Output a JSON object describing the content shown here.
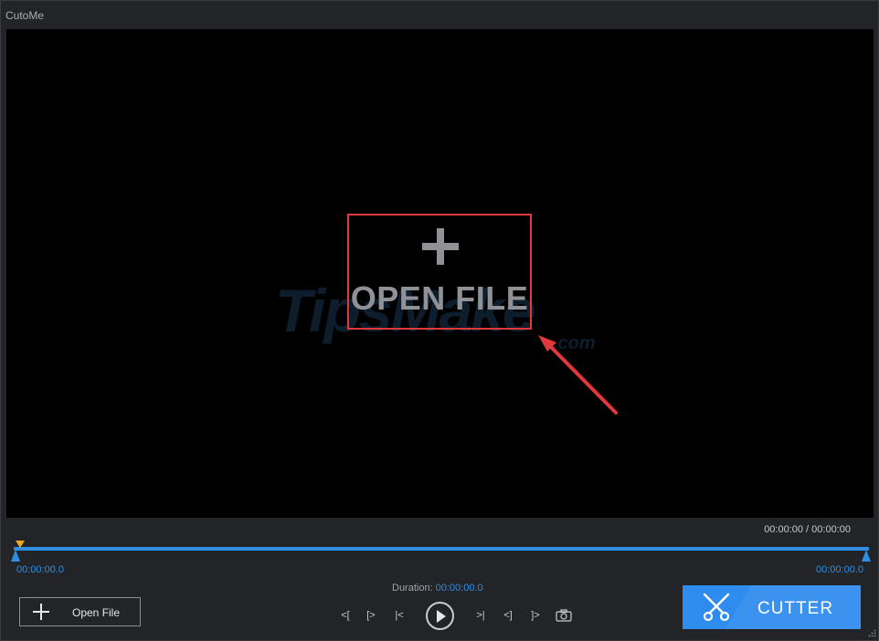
{
  "window": {
    "title": "CutoMe"
  },
  "player": {
    "open_file_label": "OPEN FILE",
    "watermark": "TipsMake",
    "watermark_suffix": ".com",
    "time_readout": "00:00:00 / 00:00:00"
  },
  "timeline": {
    "start_time": "00:00:00.0",
    "end_time": "00:00:00.0",
    "duration_label": "Duration:",
    "duration_value": "00:00:00.0"
  },
  "controls": {
    "set_start_label": "<[",
    "goto_start_label": "[>",
    "prev_frame_label": "|<",
    "next_frame_label": ">|",
    "goto_end_label": "<]",
    "set_end_label": "]>"
  },
  "bottom_bar": {
    "open_file_button": "Open File",
    "cutter_button": "CUTTER"
  },
  "colors": {
    "accent": "#2f8cef",
    "timeline": "#2d8ee3",
    "playhead": "#f2a81d",
    "highlight": "#e0383c",
    "background": "#232428",
    "player_background": "#000000"
  },
  "icons": [
    "plus-icon",
    "play-icon",
    "camera-icon",
    "scissors-icon",
    "resize-grip-icon"
  ]
}
